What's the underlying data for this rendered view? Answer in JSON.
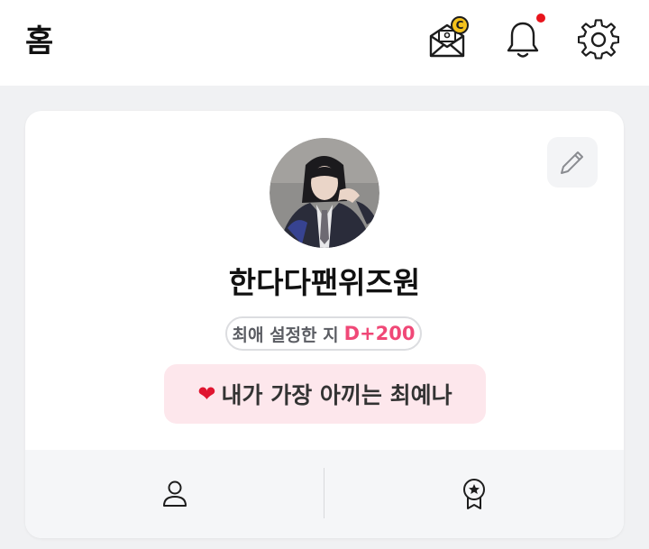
{
  "header": {
    "title": "홈",
    "coin_symbol": "C",
    "has_notification": true,
    "notification_color": "#e8141c",
    "icons": [
      "mail-coin-icon",
      "bell-icon",
      "gear-icon"
    ]
  },
  "profile": {
    "nickname": "한다다팬위즈원",
    "dday_label": "최애 설정한 지",
    "dday_value": "D+200",
    "heart": "❤",
    "message": "내가 가장 아끼는 최예나",
    "avatar": "profile-photo",
    "edit_icon": "pencil-icon"
  },
  "footer_tabs": [
    {
      "icon": "person-icon"
    },
    {
      "icon": "award-badge-icon"
    }
  ],
  "colors": {
    "accent": "#f04877",
    "message_bg": "#fde7ec",
    "background": "#f0f1f3"
  }
}
